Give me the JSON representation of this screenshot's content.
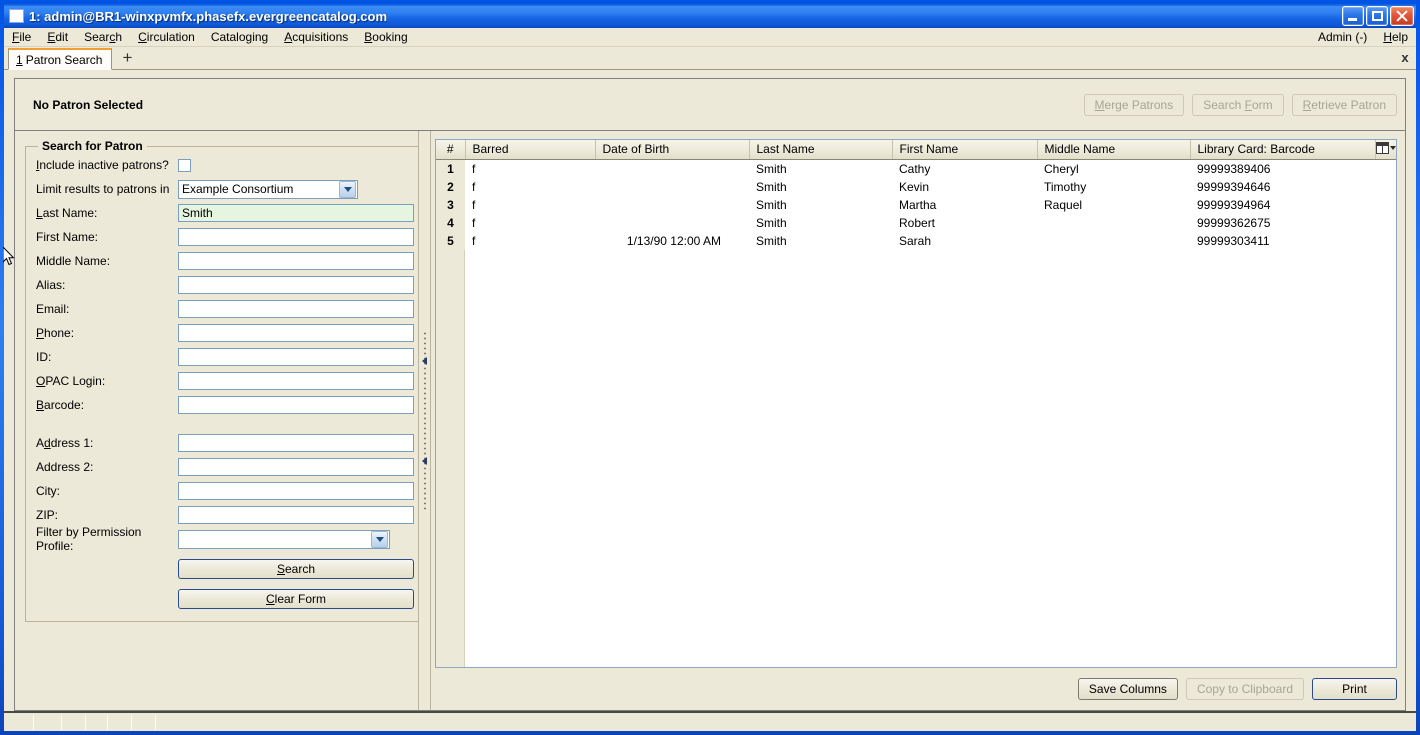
{
  "window": {
    "title": "1: admin@BR1-winxpvmfx.phasefx.evergreencatalog.com",
    "minimize_label": "Minimize",
    "maximize_label": "Maximize",
    "close_label": "Close"
  },
  "menubar": {
    "items": [
      {
        "label": "File",
        "accel": "F"
      },
      {
        "label": "Edit",
        "accel": "E"
      },
      {
        "label": "Search",
        "accel": "c"
      },
      {
        "label": "Circulation",
        "accel": "C"
      },
      {
        "label": "Cataloging",
        "accel": "g"
      },
      {
        "label": "Acquisitions",
        "accel": "A"
      },
      {
        "label": "Booking",
        "accel": "B"
      }
    ],
    "right_items": [
      {
        "label": "Admin (-)"
      },
      {
        "label": "Help"
      }
    ]
  },
  "tabs": {
    "active": {
      "number": "1",
      "label": "Patron Search"
    },
    "new_tab_label": "+",
    "close_label": "x"
  },
  "patron_bar": {
    "status": "No Patron Selected",
    "buttons": [
      {
        "label": "Merge Patrons",
        "enabled": false
      },
      {
        "label": "Search Form",
        "enabled": false
      },
      {
        "label": "Retrieve Patron",
        "enabled": false
      }
    ]
  },
  "search_form": {
    "legend": "Search for Patron",
    "include_inactive": {
      "label": "Include inactive patrons?",
      "checked": false
    },
    "limit_results": {
      "label": "Limit results to patrons in",
      "value": "Example Consortium"
    },
    "fields": [
      {
        "label": "Last Name:",
        "value": "Smith",
        "placeholder": "",
        "focused": true
      },
      {
        "label": "First Name:",
        "value": "",
        "placeholder": "",
        "focused": false
      },
      {
        "label": "Middle Name:",
        "value": "",
        "placeholder": "",
        "focused": false
      },
      {
        "label": "Alias:",
        "value": "",
        "placeholder": "",
        "focused": false
      },
      {
        "label": "Email:",
        "value": "",
        "placeholder": "",
        "focused": false
      },
      {
        "label": "Phone:",
        "value": "",
        "placeholder": "",
        "focused": false
      },
      {
        "label": "ID:",
        "value": "",
        "placeholder": "",
        "focused": false
      },
      {
        "label": "OPAC Login:",
        "value": "",
        "placeholder": "",
        "focused": false
      },
      {
        "label": "Barcode:",
        "value": "",
        "placeholder": "",
        "focused": false
      }
    ],
    "address_fields": [
      {
        "label": "Address 1:",
        "value": "",
        "placeholder": ""
      },
      {
        "label": "Address 2:",
        "value": "",
        "placeholder": ""
      },
      {
        "label": "City:",
        "value": "",
        "placeholder": ""
      },
      {
        "label": "ZIP:",
        "value": "",
        "placeholder": ""
      }
    ],
    "permission_profile": {
      "label": "Filter by Permission Profile:",
      "value": ""
    },
    "search_button": "Search",
    "clear_button": "Clear Form"
  },
  "results": {
    "columns": [
      "#",
      "Barred",
      "Date of Birth",
      "Last Name",
      "First Name",
      "Middle Name",
      "Library Card: Barcode"
    ],
    "column_picker_label": "Column Picker",
    "rows": [
      {
        "num": "1",
        "barred": "f",
        "dob": "",
        "last": "Smith",
        "first": "Cathy",
        "middle": "Cheryl",
        "barcode": "99999389406"
      },
      {
        "num": "2",
        "barred": "f",
        "dob": "",
        "last": "Smith",
        "first": "Kevin",
        "middle": "Timothy",
        "barcode": "99999394646"
      },
      {
        "num": "3",
        "barred": "f",
        "dob": "",
        "last": "Smith",
        "first": "Martha",
        "middle": "Raquel",
        "barcode": "99999394964"
      },
      {
        "num": "4",
        "barred": "f",
        "dob": "",
        "last": "Smith",
        "first": "Robert",
        "middle": "",
        "barcode": "99999362675"
      },
      {
        "num": "5",
        "barred": "f",
        "dob": "1/13/90 12:00 AM",
        "last": "Smith",
        "first": "Sarah",
        "middle": "",
        "barcode": "99999303411"
      }
    ],
    "footer_buttons": [
      {
        "label": "Save Columns",
        "enabled": true
      },
      {
        "label": "Copy to Clipboard",
        "enabled": false
      },
      {
        "label": "Print",
        "enabled": true
      }
    ]
  },
  "colors": {
    "window_chrome": "#ece9d8",
    "title_blue": "#0a5ae8",
    "tab_accent": "#f0a030",
    "field_focus": "#e6f5e0",
    "field_border": "#7b9ebd"
  }
}
